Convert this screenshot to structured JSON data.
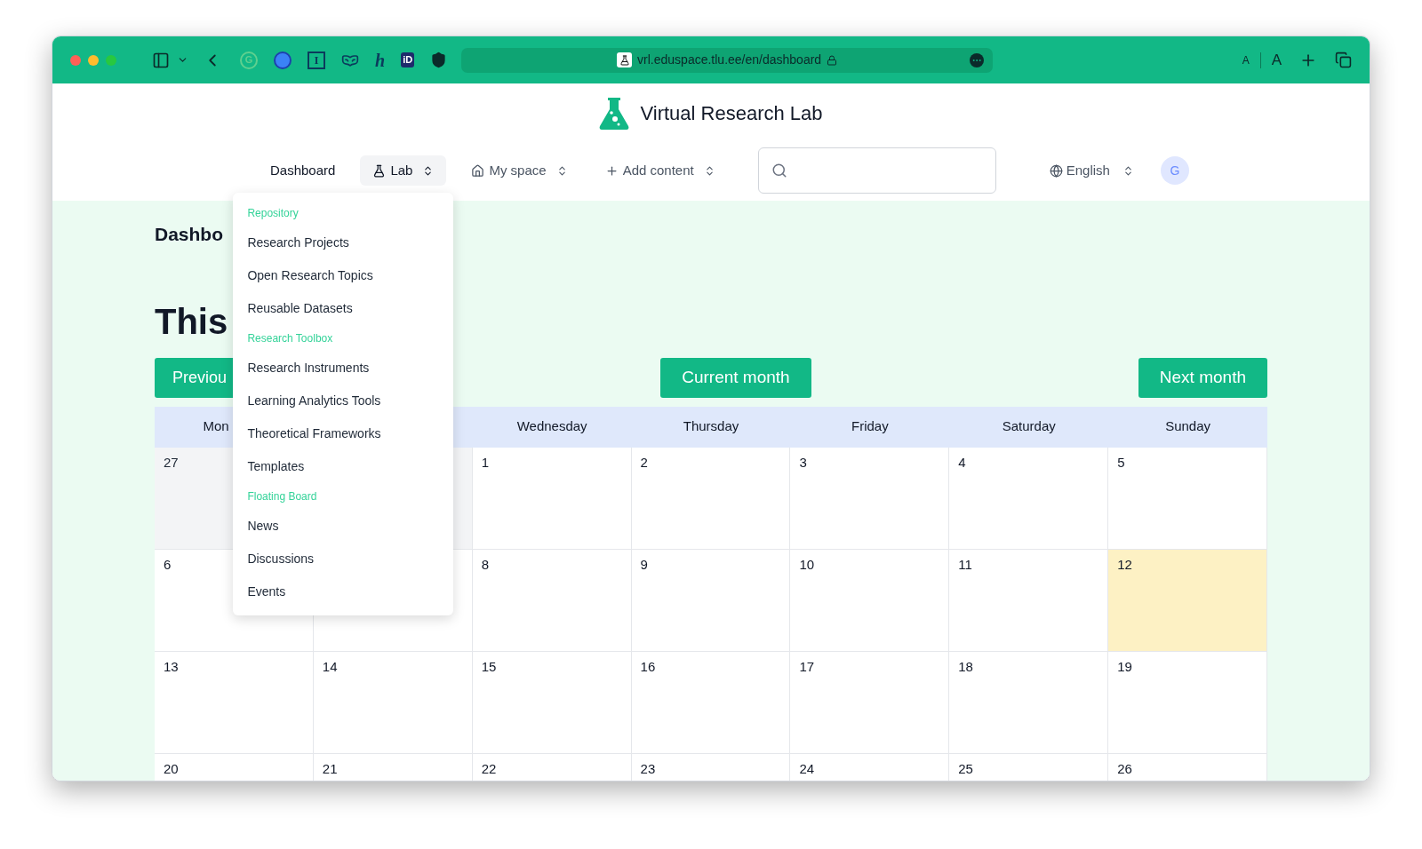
{
  "browser": {
    "url": "vrl.eduspace.tlu.ee/en/dashboard",
    "extensions": [
      {
        "kind": "letter-ring",
        "label": "G"
      },
      {
        "kind": "blob"
      },
      {
        "kind": "letter-box",
        "label": "I"
      },
      {
        "kind": "mask"
      },
      {
        "kind": "letter",
        "label": "h"
      },
      {
        "kind": "letter-badge",
        "label": "iD"
      },
      {
        "kind": "shield"
      }
    ],
    "text_size_small": "A",
    "text_size_large": "A"
  },
  "site": {
    "title": "Virtual Research Lab"
  },
  "nav": [
    {
      "kind": "plain",
      "label": "Dashboard",
      "expanded": false
    },
    {
      "kind": "lab",
      "label": "Lab",
      "expanded": true
    },
    {
      "kind": "home",
      "label": "My space",
      "expanded": false
    },
    {
      "kind": "add",
      "label": "Add content",
      "expanded": false
    }
  ],
  "language": {
    "label": "English"
  },
  "avatar": {
    "initial": "G"
  },
  "menu": [
    {
      "kind": "heading",
      "label": "Repository"
    },
    {
      "kind": "link",
      "label": "Research Projects"
    },
    {
      "kind": "link",
      "label": "Open Research Topics"
    },
    {
      "kind": "link",
      "label": "Reusable Datasets"
    },
    {
      "kind": "heading",
      "label": "Research Toolbox"
    },
    {
      "kind": "link",
      "label": "Research Instruments"
    },
    {
      "kind": "link",
      "label": "Learning Analytics Tools"
    },
    {
      "kind": "link",
      "label": "Theoretical Frameworks"
    },
    {
      "kind": "link",
      "label": "Templates"
    },
    {
      "kind": "heading",
      "label": "Floating Board"
    },
    {
      "kind": "link",
      "label": "News"
    },
    {
      "kind": "link",
      "label": "Discussions"
    },
    {
      "kind": "link",
      "label": "Events"
    }
  ],
  "page": {
    "heading": "Dashbo",
    "subheading": "This"
  },
  "calendar": {
    "previous": "Previou",
    "current": "Current month",
    "next": "Next month",
    "weekdays": [
      {
        "label": "Mon",
        "cut": true
      },
      {
        "label": "Wednesday",
        "cut": false
      },
      {
        "label": "Thursday",
        "cut": false
      },
      {
        "label": "Friday",
        "cut": false
      },
      {
        "label": "Saturday",
        "cut": false
      },
      {
        "label": "Sunday",
        "cut": false
      }
    ],
    "weeks": [
      [
        {
          "day": "27",
          "outside": true,
          "today": false
        },
        {
          "outside": true,
          "today": false
        },
        {
          "day": "1",
          "outside": false,
          "today": false
        },
        {
          "day": "2",
          "outside": false,
          "today": false
        },
        {
          "day": "3",
          "outside": false,
          "today": false
        },
        {
          "day": "4",
          "outside": false,
          "today": false
        },
        {
          "day": "5",
          "outside": false,
          "today": false
        }
      ],
      [
        {
          "day": "6",
          "outside": false,
          "today": false
        },
        {
          "outside": false,
          "today": false
        },
        {
          "day": "8",
          "outside": false,
          "today": false
        },
        {
          "day": "9",
          "outside": false,
          "today": false
        },
        {
          "day": "10",
          "outside": false,
          "today": false
        },
        {
          "day": "11",
          "outside": false,
          "today": false
        },
        {
          "day": "12",
          "outside": false,
          "today": true
        }
      ],
      [
        {
          "day": "13",
          "outside": false,
          "today": false
        },
        {
          "day": "14",
          "outside": false,
          "today": false
        },
        {
          "day": "15",
          "outside": false,
          "today": false
        },
        {
          "day": "16",
          "outside": false,
          "today": false
        },
        {
          "day": "17",
          "outside": false,
          "today": false
        },
        {
          "day": "18",
          "outside": false,
          "today": false
        },
        {
          "day": "19",
          "outside": false,
          "today": false
        }
      ],
      [
        {
          "day": "20",
          "outside": false,
          "today": false
        },
        {
          "day": "21",
          "outside": false,
          "today": false
        },
        {
          "day": "22",
          "outside": false,
          "today": false
        },
        {
          "day": "23",
          "outside": false,
          "today": false
        },
        {
          "day": "24",
          "outside": false,
          "today": false
        },
        {
          "day": "25",
          "outside": false,
          "today": false
        },
        {
          "day": "26",
          "outside": false,
          "today": false
        }
      ]
    ]
  }
}
